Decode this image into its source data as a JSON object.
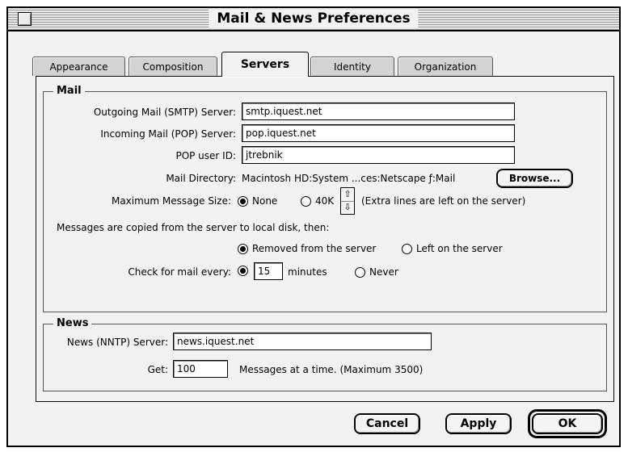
{
  "window": {
    "title": "Mail & News Preferences"
  },
  "tabs": [
    {
      "label": "Appearance"
    },
    {
      "label": "Composition"
    },
    {
      "label": "Servers"
    },
    {
      "label": "Identity"
    },
    {
      "label": "Organization"
    }
  ],
  "mail": {
    "group_label": "Mail",
    "smtp_label": "Outgoing Mail (SMTP) Server:",
    "smtp_value": "smtp.iquest.net",
    "pop_label": "Incoming Mail (POP) Server:",
    "pop_value": "pop.iquest.net",
    "userid_label": "POP user ID:",
    "userid_value": "jtrebnik",
    "dir_label": "Mail Directory:",
    "dir_value": "Macintosh HD:System ...ces:Netscape ƒ:Mail",
    "browse_label": "Browse...",
    "maxsize_label": "Maximum Message Size:",
    "maxsize_none": "None",
    "maxsize_40k": "40K",
    "maxsize_note": "(Extra lines are left on the server)",
    "copied_label": "Messages are copied from the server to local disk, then:",
    "removed_label": "Removed from the server",
    "left_label": "Left on the server",
    "check_label": "Check for mail every:",
    "check_value": "15",
    "minutes_label": "minutes",
    "never_label": "Never"
  },
  "news": {
    "group_label": "News",
    "nntp_label": "News (NNTP) Server:",
    "nntp_value": "news.iquest.net",
    "get_label": "Get:",
    "get_value": "100",
    "get_note": "Messages at a time. (Maximum 3500)"
  },
  "buttons": {
    "cancel": "Cancel",
    "apply": "Apply",
    "ok": "OK"
  }
}
